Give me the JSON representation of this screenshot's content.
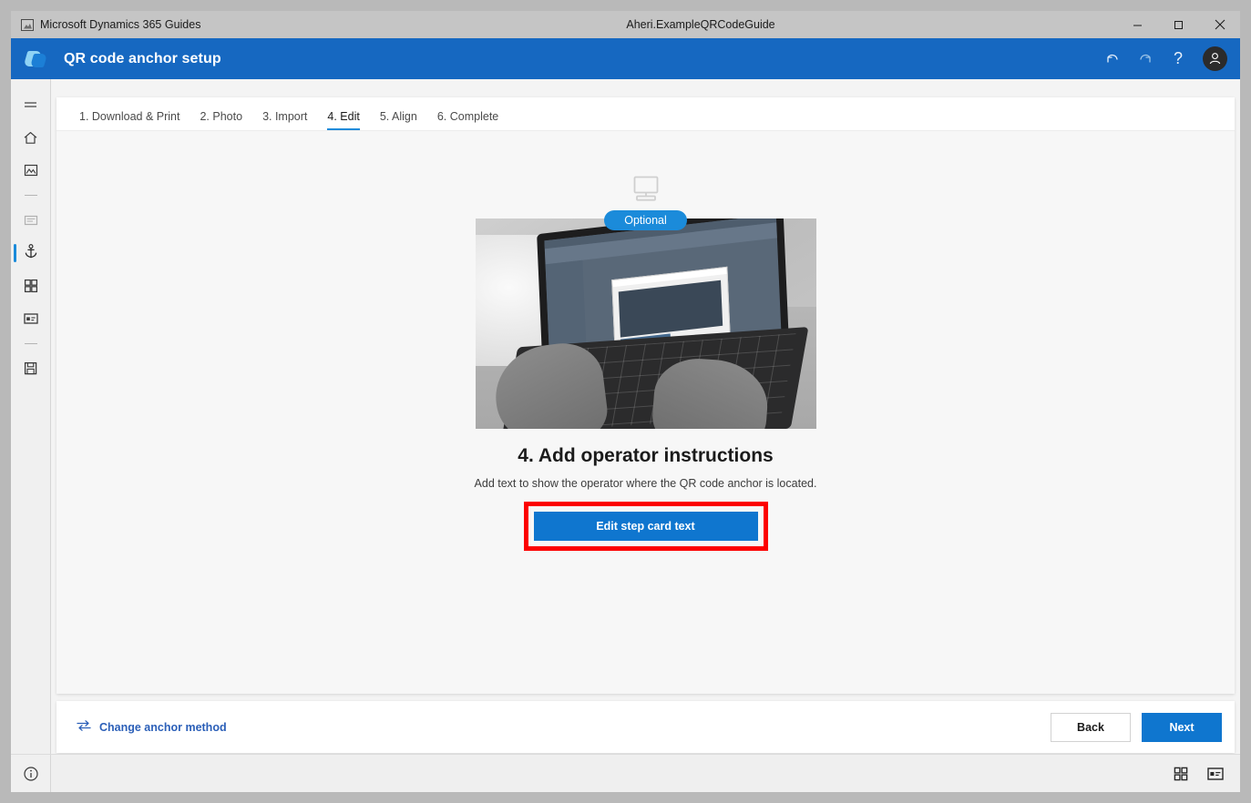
{
  "titlebar": {
    "app_name": "Microsoft Dynamics 365 Guides",
    "document_title": "Aheri.ExampleQRCodeGuide",
    "app_icon": "picture-icon",
    "minimize_label": "–",
    "maximize_label": "❐",
    "close_label": "✕"
  },
  "header": {
    "title": "QR code anchor setup",
    "logo": "dynamics-guides-logo",
    "actions": [
      {
        "name": "undo-icon",
        "glyph": "↶"
      },
      {
        "name": "redo-icon",
        "glyph": "↷"
      },
      {
        "name": "help-icon",
        "glyph": "?"
      }
    ],
    "avatar": "user-avatar-icon",
    "accent_color": "#1668c1"
  },
  "sidebar": {
    "items": [
      {
        "name": "hamburger-menu-icon",
        "label": "Menu",
        "state": "default"
      },
      {
        "name": "home-icon",
        "label": "Home",
        "state": "default"
      },
      {
        "name": "image-icon",
        "label": "Media",
        "state": "default"
      },
      {
        "name": "step-card-icon",
        "label": "Step card",
        "state": "disabled"
      },
      {
        "name": "anchor-icon",
        "label": "Anchor",
        "state": "active"
      },
      {
        "name": "grid-icon",
        "label": "Apps",
        "state": "default"
      },
      {
        "name": "media-card-icon",
        "label": "Card",
        "state": "default"
      },
      {
        "name": "save-icon",
        "label": "Save",
        "state": "default"
      }
    ],
    "info_icon": "info-circle-icon",
    "active_indicator_color": "#1b8bda"
  },
  "tabs": [
    {
      "label": "1. Download & Print",
      "active": false
    },
    {
      "label": "2. Photo",
      "active": false
    },
    {
      "label": "3. Import",
      "active": false
    },
    {
      "label": "4. Edit",
      "active": true
    },
    {
      "label": "5. Align",
      "active": false
    },
    {
      "label": "6. Complete",
      "active": false
    }
  ],
  "main": {
    "illustration_icon": "desktop-monitor-icon",
    "badge": "Optional",
    "badge_color": "#1b8bda",
    "photo_alt": "Hands typing on laptop showing QR code anchor dialog",
    "step_title": "4. Add operator instructions",
    "step_description": "Add text to show the operator where the QR code anchor is located.",
    "edit_button": "Edit step card text",
    "edit_button_color": "#0f76cf",
    "highlight_color": "#fc0000"
  },
  "footer": {
    "change_anchor_label": "Change anchor method",
    "change_anchor_icon": "swap-arrows-icon",
    "change_anchor_color": "#2b5fb8",
    "back_label": "Back",
    "next_label": "Next"
  },
  "statusbar": {
    "icons": [
      {
        "name": "grid-view-icon"
      },
      {
        "name": "card-view-icon"
      }
    ]
  }
}
